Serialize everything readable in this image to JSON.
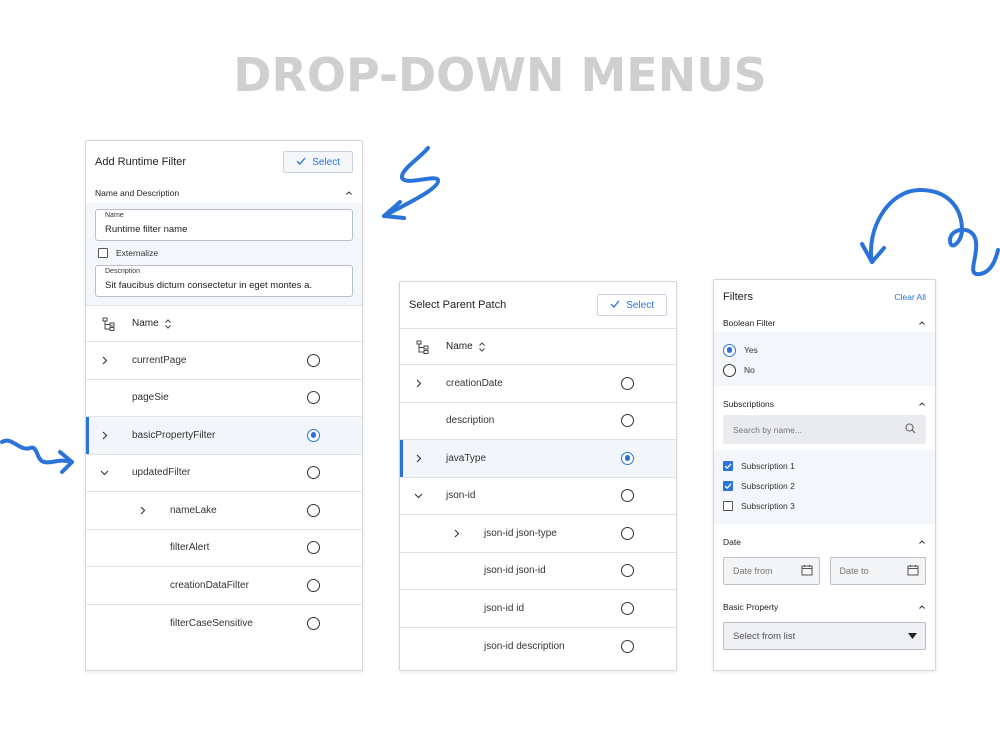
{
  "page_title": "DROP-DOWN MENUS",
  "accent_color": "#2a73d9",
  "panel1": {
    "title": "Add Runtime Filter",
    "select_label": "Select",
    "section_title": "Name and Description",
    "name_label": "Name",
    "name_value": "Runtime filter name",
    "externalize_label": "Externalize",
    "description_label": "Description",
    "description_value": "Sit faucibus dictum consectetur in eget montes a.",
    "column_header": "Name",
    "rows": [
      {
        "label": "currentPage",
        "expander": "chevron-right",
        "indent": 0,
        "selected": false
      },
      {
        "label": "pageSie",
        "expander": "none",
        "indent": 0,
        "selected": false
      },
      {
        "label": "basicPropertyFilter",
        "expander": "chevron-right",
        "indent": 0,
        "selected": true
      },
      {
        "label": "updatedFilter",
        "expander": "chevron-down",
        "indent": 0,
        "selected": false
      },
      {
        "label": "nameLake",
        "expander": "chevron-right",
        "indent": 1,
        "selected": false
      },
      {
        "label": "filterAlert",
        "expander": "none",
        "indent": 1,
        "selected": false
      },
      {
        "label": "creationDataFilter",
        "expander": "none",
        "indent": 1,
        "selected": false
      },
      {
        "label": "filterCaseSensitive",
        "expander": "none",
        "indent": 1,
        "selected": false
      }
    ]
  },
  "panel2": {
    "title": "Select Parent Patch",
    "select_label": "Select",
    "column_header": "Name",
    "rows": [
      {
        "label": "creationDate",
        "expander": "chevron-right",
        "indent": 0,
        "selected": false
      },
      {
        "label": "description",
        "expander": "none",
        "indent": 0,
        "selected": false
      },
      {
        "label": "javaType",
        "expander": "chevron-right",
        "indent": 0,
        "selected": true
      },
      {
        "label": "json-id",
        "expander": "chevron-down",
        "indent": 0,
        "selected": false
      },
      {
        "label": "json-id json-type",
        "expander": "chevron-right",
        "indent": 1,
        "selected": false
      },
      {
        "label": "json-id json-id",
        "expander": "none",
        "indent": 1,
        "selected": false
      },
      {
        "label": "json-id id",
        "expander": "none",
        "indent": 1,
        "selected": false
      },
      {
        "label": "json-id description",
        "expander": "none",
        "indent": 1,
        "selected": false
      }
    ]
  },
  "filters": {
    "title": "Filters",
    "clear_all": "Clear All",
    "boolean": {
      "title": "Boolean Filter",
      "options": [
        {
          "label": "Yes",
          "selected": true
        },
        {
          "label": "No",
          "selected": false
        }
      ]
    },
    "subscriptions": {
      "title": "Subscriptions",
      "search_placeholder": "Search by name...",
      "items": [
        {
          "label": "Subscription 1",
          "checked": true
        },
        {
          "label": "Subscription 2",
          "checked": true
        },
        {
          "label": "Subscription 3",
          "checked": false
        }
      ]
    },
    "date": {
      "title": "Date",
      "from": "Date from",
      "to": "Date to"
    },
    "basic_property": {
      "title": "Basic Property",
      "placeholder": "Select from list"
    }
  }
}
